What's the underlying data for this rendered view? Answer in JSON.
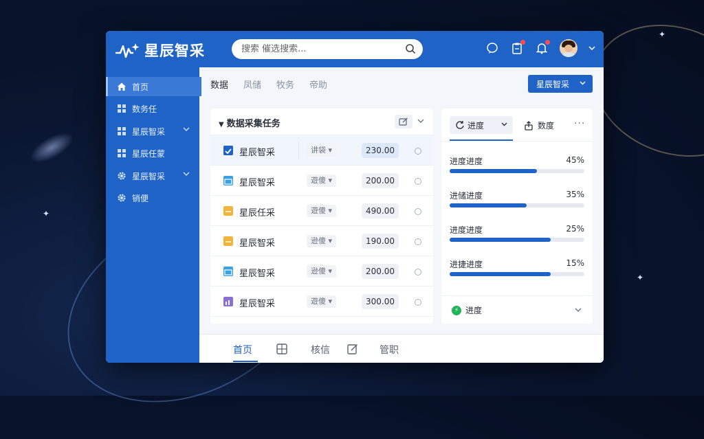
{
  "app": {
    "logo_text": "星辰智采",
    "search_placeholder": "搜索 催选搜索...",
    "accent_color": "#1f63c6"
  },
  "header_icons": [
    "chat-icon",
    "clipboard-icon",
    "bell-icon"
  ],
  "sidebar": {
    "items": [
      {
        "label": "首页",
        "icon": "home-icon",
        "active": true
      },
      {
        "label": "数务任",
        "icon": "grid-icon"
      },
      {
        "label": "星辰智采",
        "icon": "grid-icon",
        "expandable": true
      },
      {
        "label": "星辰任蒙",
        "icon": "grid-icon"
      },
      {
        "label": "星辰智采",
        "icon": "gear-icon",
        "expandable": true
      },
      {
        "label": "销便",
        "icon": "gear-icon"
      }
    ]
  },
  "main": {
    "tabs": [
      "数据",
      "凤储",
      "牧务",
      "帝助"
    ],
    "dropdown_label": "星辰智采",
    "task_panel": {
      "title": "数据采集任务",
      "rows": [
        {
          "name": "星辰智采",
          "tag": "讲袋 ▾",
          "value": "230.00",
          "icon": "checkbox-icon",
          "icon_color": "#1f63c6",
          "selected": true
        },
        {
          "name": "星辰智采",
          "tag": "遊傻 ▾",
          "value": "200.00",
          "icon": "calendar-icon",
          "icon_color": "#3aa0e0"
        },
        {
          "name": "星辰任采",
          "tag": "遊傻 ▾",
          "value": "490.00",
          "icon": "folder-icon",
          "icon_color": "#f2b53c"
        },
        {
          "name": "星辰智采",
          "tag": "逊傻 ▾",
          "value": "190.00",
          "icon": "folder-icon",
          "icon_color": "#f2b53c"
        },
        {
          "name": "星辰智采",
          "tag": "逊傻 ▾",
          "value": "200.00",
          "icon": "calendar-icon",
          "icon_color": "#3aa0e0"
        },
        {
          "name": "星辰智采",
          "tag": "遊傻 ▾",
          "value": "300.00",
          "icon": "chart-icon",
          "icon_color": "#8a6fd6"
        }
      ]
    },
    "progress_panel": {
      "active_tab": "进度",
      "second_tab": "数度",
      "items": [
        {
          "label": "进度进度",
          "value": "45%",
          "fill": 0.65
        },
        {
          "label": "进储进度",
          "value": "35%",
          "fill": 0.57
        },
        {
          "label": "进度进度",
          "value": "25%",
          "fill": 0.75
        },
        {
          "label": "进捷进度",
          "value": "15%",
          "fill": 0.75
        }
      ],
      "footer_label": "进度"
    }
  },
  "bottom_nav": {
    "items": [
      {
        "label": "首页",
        "type": "text",
        "active": true
      },
      {
        "label": "",
        "type": "icon",
        "icon": "grid-icon"
      },
      {
        "label": "核信",
        "type": "text"
      },
      {
        "label": "",
        "type": "icon",
        "icon": "edit-icon"
      },
      {
        "label": "管职",
        "type": "text"
      }
    ]
  }
}
